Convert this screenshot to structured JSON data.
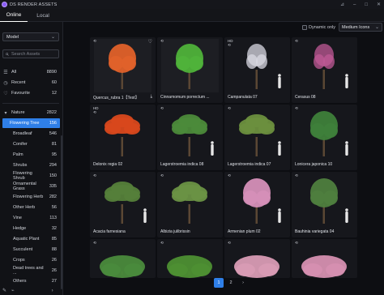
{
  "app": {
    "title": "DS RENDER ASSETS"
  },
  "window": {
    "controls": [
      "pin-icon",
      "minimize-icon",
      "maximize-icon",
      "close-icon"
    ]
  },
  "tabs": [
    {
      "label": "Online",
      "active": true
    },
    {
      "label": "Local",
      "active": false
    }
  ],
  "sidebar": {
    "model_select": "Model",
    "search_placeholder": "Search Assets",
    "quick": [
      {
        "icon": "list-icon",
        "label": "All",
        "count": "8890"
      },
      {
        "icon": "clock-icon",
        "label": "Recent",
        "count": "60"
      },
      {
        "icon": "heart-icon",
        "label": "Favourite",
        "count": "12"
      }
    ],
    "section": {
      "label": "Nature",
      "count": "2822"
    },
    "categories": [
      {
        "label": "Flowering Tree",
        "count": "156",
        "selected": true
      },
      {
        "label": "Broadleaf",
        "count": "546"
      },
      {
        "label": "Conifer",
        "count": "81"
      },
      {
        "label": "Palm",
        "count": "95"
      },
      {
        "label": "Shrubs",
        "count": "294"
      },
      {
        "label": "Flowering Shrub",
        "count": "150"
      },
      {
        "label": "Ornamental Grass",
        "count": "335"
      },
      {
        "label": "Flowering Herb",
        "count": "282"
      },
      {
        "label": "Other Herb",
        "count": "56"
      },
      {
        "label": "Vine",
        "count": "113"
      },
      {
        "label": "Hedge",
        "count": "32"
      },
      {
        "label": "Aquatic Plant",
        "count": "85"
      },
      {
        "label": "Succulent",
        "count": "88"
      },
      {
        "label": "Crops",
        "count": "26"
      },
      {
        "label": "Dead trees and ...",
        "count": "26"
      },
      {
        "label": "Others",
        "count": "27"
      }
    ]
  },
  "toolbar": {
    "dynamic_label": "Dynamic only",
    "dynamic_checked": false,
    "view_select": "Medium Icons"
  },
  "grid": [
    {
      "name": "Quercus_rubra 1【Test】",
      "badge": "",
      "color": "#e0612a",
      "shape": "round",
      "fav": true,
      "download": true,
      "person": false,
      "checker": true
    },
    {
      "name": "Cinnamomum porrectum ...",
      "badge": "",
      "color": "#4fb23a",
      "shape": "round",
      "fav": false,
      "download": false,
      "person": false,
      "checker": true
    },
    {
      "name": "Campanulata 07",
      "badge": "HD",
      "color": "#d9d9e3",
      "shape": "bare",
      "fav": false,
      "download": false,
      "person": true,
      "checker": false
    },
    {
      "name": "Cerasus 08",
      "badge": "",
      "color": "#c05a95",
      "shape": "bare",
      "fav": false,
      "download": false,
      "person": true,
      "checker": false
    },
    {
      "name": "Delonix regia 02",
      "badge": "HD",
      "color": "#d8481c",
      "shape": "wide",
      "fav": false,
      "download": false,
      "person": false,
      "checker": false
    },
    {
      "name": "Lagerstroemia indica 08",
      "badge": "",
      "color": "#4c8a3a",
      "shape": "wide",
      "fav": false,
      "download": false,
      "person": true,
      "checker": false
    },
    {
      "name": "Lagerstroemia indica 07",
      "badge": "",
      "color": "#6b8f3e",
      "shape": "wide",
      "fav": false,
      "download": false,
      "person": true,
      "checker": false
    },
    {
      "name": "Lonicera japonica 10",
      "badge": "",
      "color": "#3e7f3a",
      "shape": "round",
      "fav": false,
      "download": false,
      "person": true,
      "checker": false
    },
    {
      "name": "Acacia farnesiana",
      "badge": "",
      "color": "#55803a",
      "shape": "wide",
      "fav": false,
      "download": false,
      "person": true,
      "checker": false
    },
    {
      "name": "Albizia julibrissin",
      "badge": "",
      "color": "#6a9244",
      "shape": "wide",
      "fav": false,
      "download": false,
      "person": false,
      "checker": false
    },
    {
      "name": "Armenian plum 02",
      "badge": "",
      "color": "#d58fb8",
      "shape": "round",
      "fav": false,
      "download": false,
      "person": true,
      "checker": false
    },
    {
      "name": "Bauhinia variegata 04",
      "badge": "",
      "color": "#4e7e3e",
      "shape": "round",
      "fav": false,
      "download": false,
      "person": true,
      "checker": false
    },
    {
      "name": "",
      "badge": "",
      "color": "#4a8a3c",
      "shape": "bush",
      "fav": false,
      "download": false,
      "person": false,
      "checker": false
    },
    {
      "name": "",
      "badge": "",
      "color": "#4d8f33",
      "shape": "bush",
      "fav": false,
      "download": false,
      "person": false,
      "checker": false
    },
    {
      "name": "",
      "badge": "",
      "color": "#d89bb4",
      "shape": "bush",
      "fav": false,
      "download": false,
      "person": false,
      "checker": false
    },
    {
      "name": "",
      "badge": "",
      "color": "#d58fb0",
      "shape": "bush",
      "fav": false,
      "download": false,
      "person": false,
      "checker": false
    }
  ],
  "pagination": {
    "pages": [
      "1",
      "2"
    ],
    "current": "1",
    "next": "›"
  }
}
